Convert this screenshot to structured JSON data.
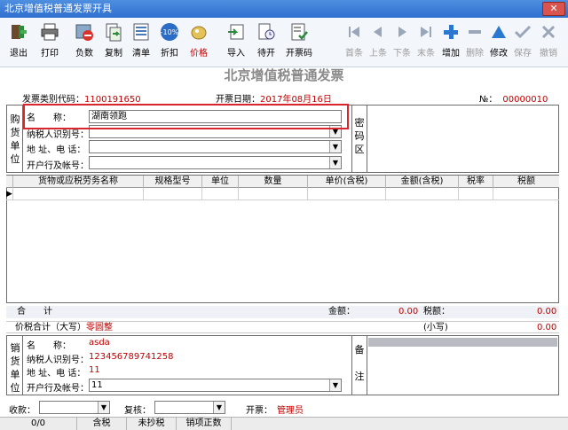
{
  "window": {
    "title": "北京增值税普通发票开具",
    "close": "✕"
  },
  "toolbar": {
    "left": [
      {
        "name": "exit-button",
        "label": "退出",
        "icon": "exit-icon"
      },
      {
        "name": "print-button",
        "label": "打印",
        "icon": "print-icon"
      },
      {
        "name": "negative-button",
        "label": "负数",
        "icon": "negative-icon"
      },
      {
        "name": "copy-button",
        "label": "复制",
        "icon": "copy-icon"
      },
      {
        "name": "list-button",
        "label": "清单",
        "icon": "list-icon"
      },
      {
        "name": "discount-button",
        "label": "折扣",
        "icon": "discount-icon",
        "badge": "-10%"
      },
      {
        "name": "price-button",
        "label": "价格",
        "icon": "price-icon"
      },
      {
        "name": "import-button",
        "label": "导入",
        "icon": "import-icon"
      },
      {
        "name": "pending-button",
        "label": "待开",
        "icon": "pending-icon"
      },
      {
        "name": "issue-code-button",
        "label": "开票码",
        "icon": "issue-code-icon"
      }
    ],
    "right": [
      {
        "name": "first-button",
        "label": "首条",
        "icon": "first-icon",
        "disabled": true
      },
      {
        "name": "prev-button",
        "label": "上条",
        "icon": "prev-icon",
        "disabled": true
      },
      {
        "name": "next-button",
        "label": "下条",
        "icon": "next-icon",
        "disabled": true
      },
      {
        "name": "last-button",
        "label": "末条",
        "icon": "last-icon",
        "disabled": true
      },
      {
        "name": "add-button",
        "label": "增加",
        "icon": "add-icon",
        "disabled": false
      },
      {
        "name": "delete-button",
        "label": "删除",
        "icon": "delete-icon",
        "disabled": true
      },
      {
        "name": "edit-button",
        "label": "修改",
        "icon": "edit-icon",
        "disabled": false
      },
      {
        "name": "save-button",
        "label": "保存",
        "icon": "save-icon",
        "disabled": true
      },
      {
        "name": "cancel-button",
        "label": "撤销",
        "icon": "cancel-icon",
        "disabled": true
      }
    ]
  },
  "invoice": {
    "title": "北京增值税普通发票",
    "category_label": "发票类别代码：",
    "category_value": "1100191650",
    "date_label": "开票日期：",
    "date_value": "2017年08月16日",
    "no_label": "№：",
    "no_value": "00000010"
  },
  "buyer": {
    "section_label": "购\n货\n单\n位",
    "name_label": "名　　称：",
    "name_value": "湖南领跑",
    "taxid_label": "纳税人识别号：",
    "taxid_value": "",
    "address_label": "地 址、电 话：",
    "address_value": "",
    "bank_label": "开户行及帐号：",
    "bank_value": "",
    "cipher_label": "密\n码\n区"
  },
  "items": {
    "headers": [
      "货物或应税劳务名称",
      "规格型号",
      "单位",
      "数量",
      "单价(含税)",
      "金额(含税)",
      "税率",
      "税额"
    ],
    "row_marker": "▶"
  },
  "totals": {
    "sum_label": "合　　计",
    "amount_label": "金额：",
    "amount_value": "0.00",
    "tax_label": "税额：",
    "tax_value": "0.00",
    "capital_label": "价税合计（大写）",
    "capital_value": "零圆整",
    "small_label": "(小写)",
    "small_value": "0.00"
  },
  "seller": {
    "section_label": "销\n货\n单\n位",
    "name_label": "名　　称：",
    "name_value": "asda",
    "taxid_label": "纳税人识别号：",
    "taxid_value": "123456789741258",
    "address_label": "地 址、电 话：",
    "address_value": "11",
    "bank_label": "开户行及帐号：",
    "bank_value": "11",
    "note_label": "备\n\n注"
  },
  "footer": {
    "payee_label": "收款：",
    "reviewer_label": "复核：",
    "issuer_label": "开票：",
    "issuer_value": "管理员"
  },
  "statusbar": {
    "items": [
      "0/0",
      "含税",
      "未抄税",
      "销项正数"
    ]
  },
  "colors": {
    "accent_red": "#c00000",
    "highlight": "#d7262e"
  }
}
